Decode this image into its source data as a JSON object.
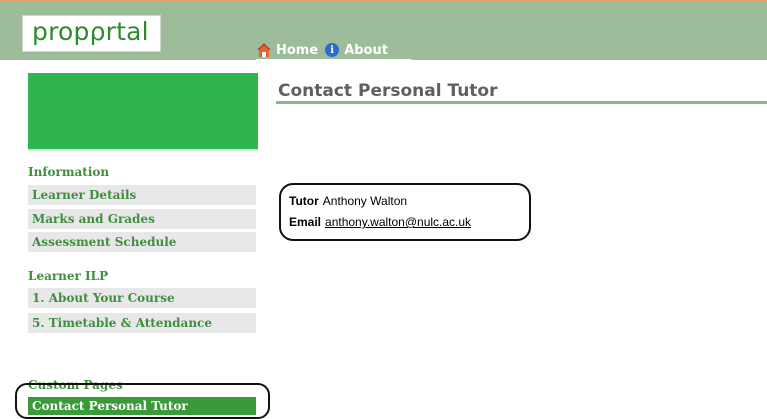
{
  "brand": {
    "logo_text": "propρrtal"
  },
  "nav": {
    "home_label": "Home",
    "about_label": "About"
  },
  "sidebar": {
    "section_information": "Information",
    "information_items": [
      "Learner Details",
      "Marks and Grades",
      "Assessment Schedule"
    ],
    "section_ilp": "Learner ILP",
    "ilp_items": [
      "1. About Your Course",
      "5. Timetable & Attendance"
    ],
    "section_custom": "Custom Pages",
    "custom_items": [
      "Contact Personal Tutor"
    ]
  },
  "main": {
    "title": "Contact Personal Tutor",
    "tutor_label": "Tutor",
    "tutor_name": "Anthony Walton",
    "email_label": "Email",
    "email_value": "anthony.walton@nulc.ac.uk"
  },
  "colors": {
    "header_band": "#9dbd9a",
    "accent_green": "#3f8f3f",
    "active_item": "#3a9a3a",
    "hero_block": "#2fb54e"
  }
}
